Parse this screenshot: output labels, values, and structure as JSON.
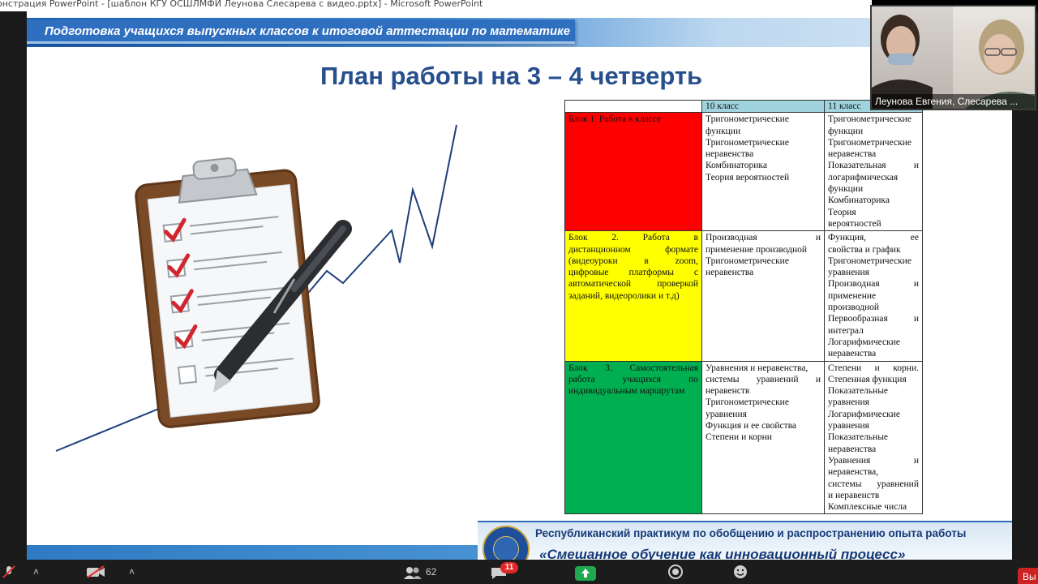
{
  "window": {
    "title": "онстрация PowerPoint - [шаблон КГУ ОСШЛМФИ Леунова Слесарева с видео.pptx] - Microsoft PowerPoint"
  },
  "slide": {
    "header_text": "Подготовка учащихся выпускных классов к итоговой аттестации по математике",
    "title": "План работы на 3 – 4 четверть",
    "table": {
      "col_headers": [
        "10 класс",
        "11 класс"
      ],
      "rows": [
        {
          "block": "Блок 1. Работа в классе",
          "color": "#ff0000",
          "grade10": [
            "Тригонометрические",
            "функции",
            "Тригонометрические",
            "неравенства",
            "Комбинаторика",
            "Теория вероятностей"
          ],
          "grade11": [
            "Тригонометрические",
            "функции",
            "Тригонометрические",
            "неравенства",
            "Показательная и",
            "логарифмическая",
            "функции",
            "Комбинаторика",
            "Теория",
            "вероятностей"
          ]
        },
        {
          "block_lines": [
            "Блок 2. Работа в",
            "дистанционном формате",
            "(видеоуроки в zoom,",
            "цифровые платформы с",
            "автоматической проверкой",
            "заданий, видеоролики и т.д)"
          ],
          "color": "#ffff00",
          "grade10": [
            "Производная и",
            "применение производной",
            "Тригонометрические",
            "неравенства"
          ],
          "grade11": [
            "Функция, ее",
            "свойства и график",
            "Тригонометрические",
            "уравнения",
            "Производная и",
            "применение",
            "производной",
            "Первообразная и",
            "интеграл",
            "Логарифмические",
            "неравенства"
          ]
        },
        {
          "block_lines": [
            "Блок 3. Самостоятельная",
            "работа учащихся по",
            "индивидуальным маршрутам"
          ],
          "color": "#00b050",
          "grade10": [
            "Уравнения и неравенства,",
            "системы уравнений и",
            "неравенств",
            "Тригонометрические",
            "уравнения",
            "Функция и ее свойства",
            "Степени и корни"
          ],
          "grade11": [
            "Степени и корни.",
            "Степенная функция",
            "Показательные",
            "уравнения",
            "Логарифмические",
            "уравнения",
            "Показательные",
            "неравенства",
            "Уравнения и",
            "неравенства,",
            "системы уравнений",
            "и неравенств",
            "Комплексные числа"
          ]
        }
      ]
    },
    "footer_line1": "Республиканский практикум по обобщению и распространению опыта работы",
    "footer_line2": "«Смешанное обучение как инновационный процесс»"
  },
  "video": {
    "participants_label": "Леунова Евгения, Слесарева ..."
  },
  "toolbar": {
    "participants_count": "62",
    "chat_badge": "11",
    "end_label": "Вы"
  }
}
